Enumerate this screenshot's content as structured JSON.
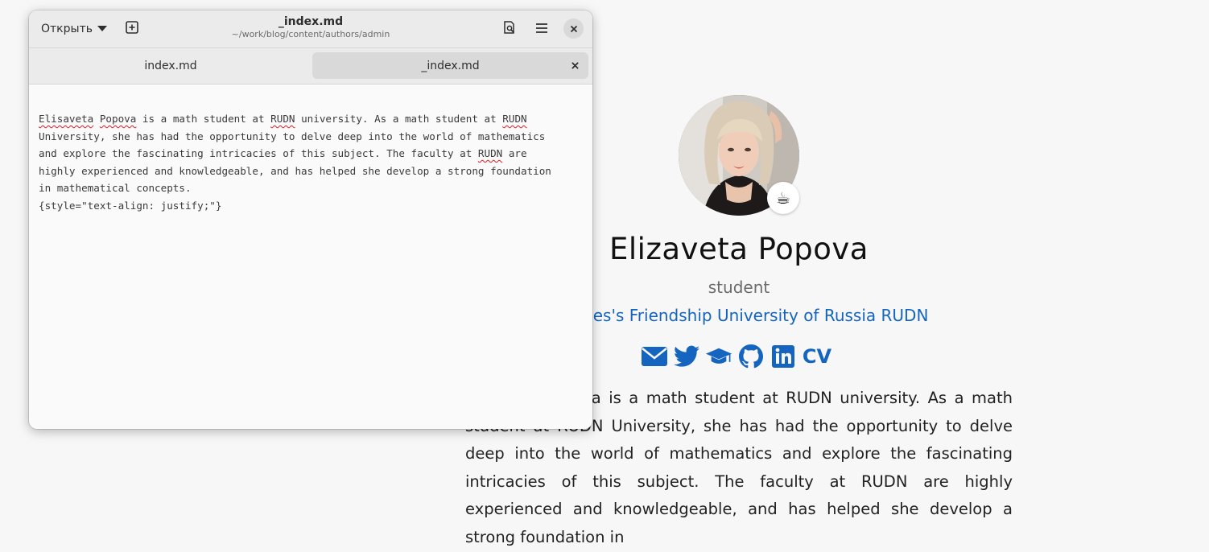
{
  "editor": {
    "open_label": "Открыть",
    "title": "_index.md",
    "subtitle": "~/work/blog/content/authors/admin",
    "tabs": [
      {
        "label": "index.md",
        "active": false
      },
      {
        "label": "_index.md",
        "active": true
      }
    ],
    "icons": {
      "open_dropdown": "chevron-down-icon",
      "new_tab": "new-tab-icon",
      "find": "find-icon",
      "menu": "hamburger-menu-icon",
      "close": "close-icon"
    },
    "lines": [
      [
        {
          "text": "Elisaveta",
          "misspelled": true
        },
        {
          "text": " ",
          "misspelled": false
        },
        {
          "text": "Popova",
          "misspelled": true
        },
        {
          "text": " is a math student at ",
          "misspelled": false
        },
        {
          "text": "RUDN",
          "misspelled": true
        },
        {
          "text": " university. As a math student at ",
          "misspelled": false
        },
        {
          "text": "RUDN",
          "misspelled": true
        }
      ],
      [
        {
          "text": "University, she has had the opportunity to delve deep into the world of mathematics",
          "misspelled": false
        }
      ],
      [
        {
          "text": "and explore the fascinating intricacies of this subject. The faculty at ",
          "misspelled": false
        },
        {
          "text": "RUDN",
          "misspelled": true
        },
        {
          "text": " are",
          "misspelled": false
        }
      ],
      [
        {
          "text": "highly experienced and knowledgeable, and has helped she develop a strong foundation",
          "misspelled": false
        }
      ],
      [
        {
          "text": "in mathematical concepts.",
          "misspelled": false
        }
      ],
      [
        {
          "text": "{style=\"text-align: justify;\"}",
          "misspelled": false
        }
      ]
    ]
  },
  "profile": {
    "avatar_alt": "avatar",
    "status_emoji": "☕",
    "name": "Elizaveta Popova",
    "role": "student",
    "organization": "Peoples's Friendship University of Russia RUDN",
    "social": [
      {
        "icon": "envelope-icon"
      },
      {
        "icon": "twitter-icon"
      },
      {
        "icon": "graduation-cap-icon"
      },
      {
        "icon": "github-icon"
      },
      {
        "icon": "linkedin-icon"
      },
      {
        "icon": "cv-icon",
        "label": "CV"
      }
    ],
    "bio": "Elisaveta Popova is a math student at RUDN university. As a math student at RUDN University, she has had the opportunity to delve deep into the world of mathematics and explore the fascinating intricacies of this subject. The faculty at RUDN are highly experienced and knowledgeable, and has helped she develop a strong foundation in"
  },
  "colors": {
    "link_blue": "#1565c0",
    "spell_error": "#e01b24",
    "page_bg": "#f7f7f7",
    "headerbar_bg": "#ebebeb"
  }
}
